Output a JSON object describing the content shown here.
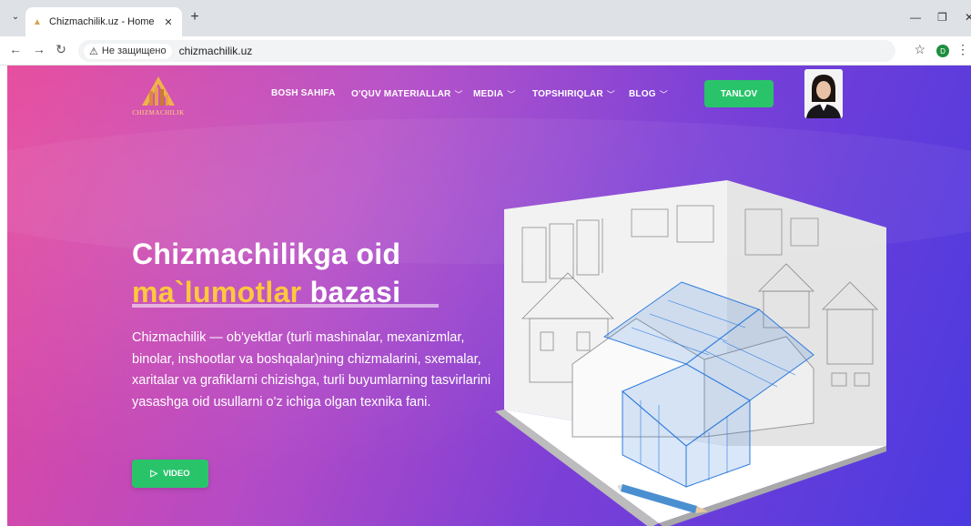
{
  "browser": {
    "tab_title": "Chizmachilik.uz - Home",
    "security_label": "Не защищено",
    "url": "chizmachilik.uz",
    "profile_initial": "D",
    "icons": [
      "tab-list-icon",
      "close-icon",
      "plus-icon",
      "minimize-icon",
      "restore-icon",
      "back-icon",
      "forward-icon",
      "reload-icon",
      "warning-icon",
      "star-icon",
      "kebab-icon"
    ]
  },
  "site": {
    "logo_text": "CHIZMACHILIK",
    "nav": [
      {
        "label": "BOSH SAHIFA"
      },
      {
        "label": "O'QUV MATERIALLAR"
      },
      {
        "label": "MEDIA"
      },
      {
        "label": "TOPSHIRIQLAR"
      },
      {
        "label": "BLOG"
      }
    ],
    "cta_label": "TANLOV",
    "accent_color": "#29c46a",
    "highlight_color": "#ffc83d"
  },
  "hero": {
    "title_line1": "Chizmachilikga oid",
    "title_accent": "ma`lumotlar",
    "title_rest": " bazasi",
    "description": "Chizmachilik — ob'yektlar (turli mashinalar, mexanizmlar, binolar, inshootlar va boshqalar)ning chizmalarini, sxemalar, xaritalar va grafiklarni chizishga, turli buyumlarning tasvirlarini yasashga oid usullarni o'z ichiga olgan texnika fani.",
    "video_label": "VIDEO"
  }
}
